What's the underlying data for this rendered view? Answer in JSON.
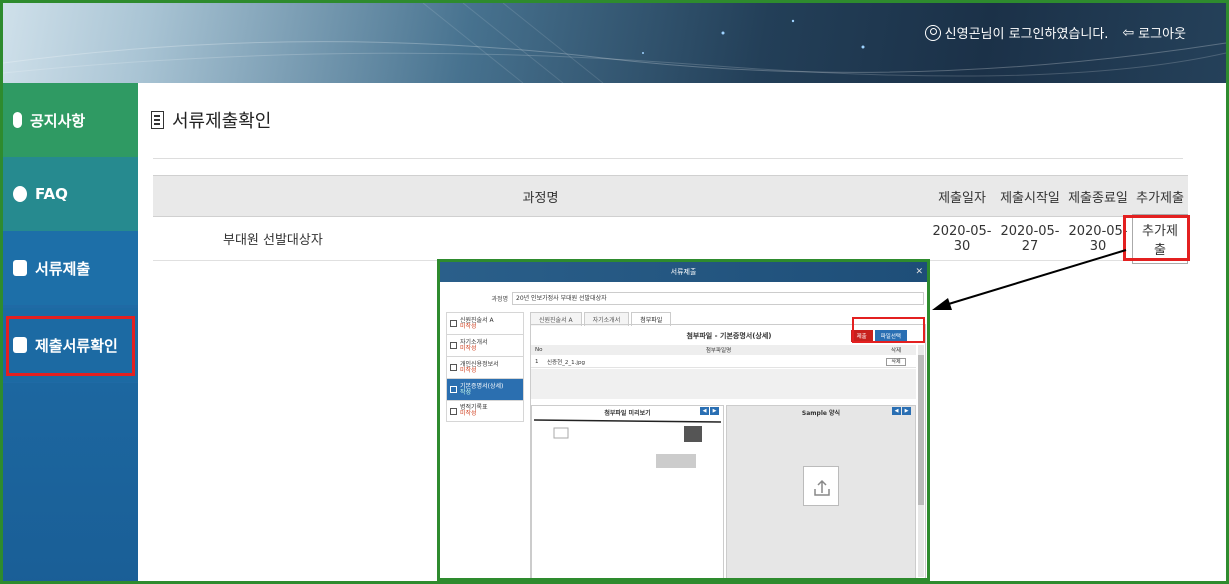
{
  "header": {
    "user_text": "신영곤님이 로그인하였습니다.",
    "logout_label": "로그아웃"
  },
  "sidebar": {
    "items": [
      {
        "label": "공지사항",
        "icon": "microphone-icon"
      },
      {
        "label": "FAQ",
        "icon": "chat-icon"
      },
      {
        "label": "서류제출",
        "icon": "upload-doc-icon"
      },
      {
        "label": "제출서류확인",
        "icon": "check-doc-icon"
      }
    ]
  },
  "page": {
    "title": "서류제출확인"
  },
  "table": {
    "headers": [
      "과정명",
      "제출일자",
      "제출시작일",
      "제출종료일",
      "추가제출"
    ],
    "rows": [
      {
        "course": "부대원 선발대상자",
        "submit_date": "2020-05-30",
        "start_date": "2020-05-27",
        "end_date": "2020-05-30",
        "action": "추가제출"
      }
    ]
  },
  "modal": {
    "title": "서류제출",
    "course_label": "과정명",
    "course_value": "20년 인보가정사 부대원 선발대상자",
    "steps": [
      {
        "name": "신원진술서 A",
        "status": "미작성"
      },
      {
        "name": "자기소개서",
        "status": "미작성"
      },
      {
        "name": "개인신용정보서",
        "status": "미작성"
      },
      {
        "name": "기본증명서(상세)",
        "status": "작성"
      },
      {
        "name": "병적기록표",
        "status": "미작성"
      }
    ],
    "tabs": [
      "신원진술서 A",
      "자기소개서",
      "첨부파일"
    ],
    "panel_title": "첨부파일 - 기본증명서(상세)",
    "btn_submit": "제출",
    "btn_file": "파일선택",
    "file_head_no": "No",
    "file_head_name": "첨부파일명",
    "file_head_del": "삭제",
    "file_row": {
      "no": "1",
      "name": "신증현_2_1.jpg",
      "del": "삭제"
    },
    "preview_title": "첨부파일 미리보기",
    "sample_title": "Sample 양식"
  }
}
